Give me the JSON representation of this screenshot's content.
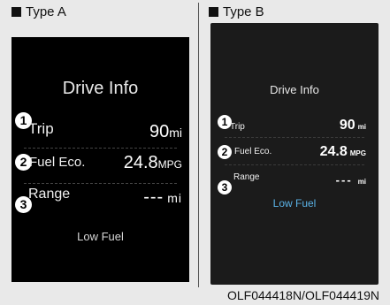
{
  "panels": [
    {
      "label": "Type A",
      "title": "Drive Info",
      "rows": [
        {
          "marker": "1",
          "label": "Trip",
          "value": "90",
          "unit": "mi"
        },
        {
          "marker": "2",
          "label": "Fuel Eco.",
          "value": "24.8",
          "unit": "MPG"
        },
        {
          "marker": "3",
          "label": "Range",
          "value": "---",
          "unit": "mi"
        }
      ],
      "status": "Low Fuel"
    },
    {
      "label": "Type B",
      "title": "Drive Info",
      "rows": [
        {
          "marker": "1",
          "label": "Trip",
          "value": "90",
          "unit": "mi"
        },
        {
          "marker": "2",
          "label": "Fuel Eco.",
          "value": "24.8",
          "unit": "MPG"
        },
        {
          "marker": "3",
          "label": "Range",
          "value": "---",
          "unit": "mi"
        }
      ],
      "status": "Low Fuel"
    }
  ],
  "footer": "OLF044418N/OLF044419N",
  "colors": {
    "screen_a_bg": "#000000",
    "screen_b_bg": "#1b1b1b",
    "low_fuel_b": "#5ab2e6"
  }
}
